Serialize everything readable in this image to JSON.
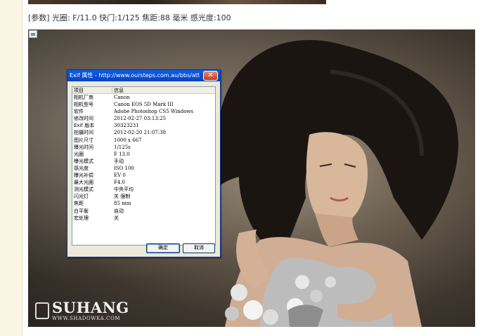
{
  "params_text": "[参数] 光圈: F/11.0 快门:1/125 焦距:88 毫米 感光度:100",
  "watermark": {
    "brand": "SUHANG",
    "url": "WWW.SHADOWKA.COM"
  },
  "dialog": {
    "title": "Exif 属性 - http://www.oursteps.com.au/bbs/attac",
    "close_glyph": "✕",
    "columns": [
      "项目",
      "信息"
    ],
    "rows": [
      [
        "相机厂商",
        "Canon"
      ],
      [
        "相机型号",
        "Canon EOS 5D Mark III"
      ],
      [
        "软件",
        "Adobe Photoshop CS5 Windows"
      ],
      [
        "修改时间",
        "2012-02-27 03:13:25"
      ],
      [
        "Exif 版本",
        "30323231"
      ],
      [
        "拍摄时间",
        "2012-02-20 21:07:38"
      ],
      [
        "图片尺寸",
        "1000 x 667"
      ],
      [
        "曝光时间",
        "1/125s"
      ],
      [
        "光圈",
        "F 13.0"
      ],
      [
        "曝光模式",
        "手动"
      ],
      [
        "感光度",
        "ISO 100"
      ],
      [
        "曝光补偿",
        "EV 0"
      ],
      [
        "最大光圈",
        "F4.0"
      ],
      [
        "测光模式",
        "中央平均"
      ],
      [
        "闪光灯",
        "关 强制"
      ],
      [
        "焦距",
        "85 mm"
      ],
      [
        "白平衡",
        "自动"
      ],
      [
        "宏处理",
        "关"
      ]
    ],
    "ok_label": "确定",
    "cancel_label": "取消"
  }
}
